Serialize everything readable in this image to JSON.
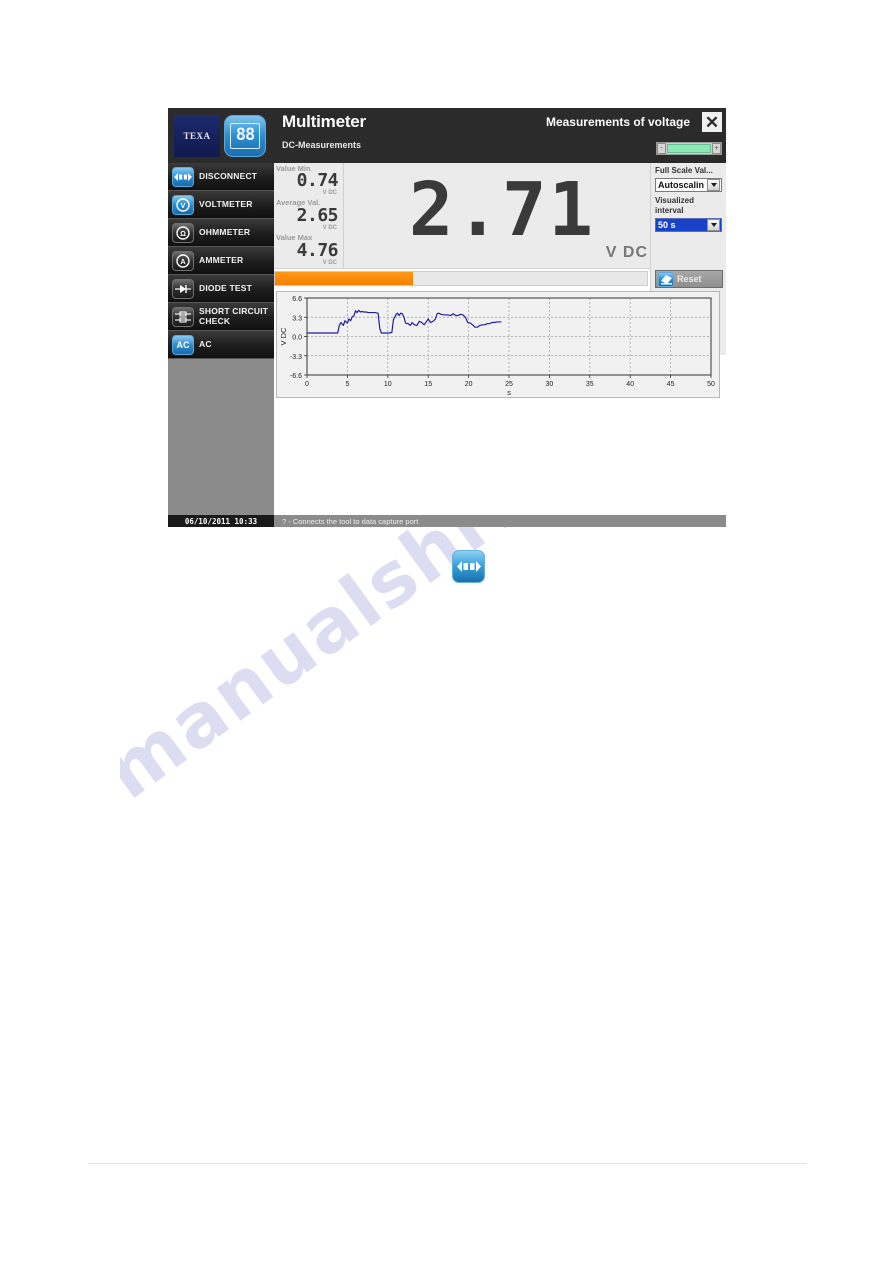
{
  "page": {
    "watermark_text": "manualshive.com"
  },
  "window": {
    "brand": {
      "logo_text": "TEXA",
      "segment_text": "88"
    },
    "title": "Multimeter",
    "subject": "Measurements of voltage",
    "subtitle": "DC-Measurements",
    "close_label": "✕",
    "slider": {
      "minus": "-",
      "plus": "+",
      "fill_percent": 100,
      "color": "#8ee8b5"
    }
  },
  "sidebar": {
    "items": [
      {
        "label": "DISCONNECT",
        "icon": "disconnect-icon",
        "icon_style": "blue",
        "active": true
      },
      {
        "label": "VOLTMETER",
        "icon": "voltmeter-icon",
        "icon_style": "blue",
        "active": false
      },
      {
        "label": "OHMMETER",
        "icon": "ohmmeter-icon",
        "icon_style": "dark",
        "active": false
      },
      {
        "label": "AMMETER",
        "icon": "ammeter-icon",
        "icon_style": "dark",
        "active": false
      },
      {
        "label": "DIODE TEST",
        "icon": "diode-icon",
        "icon_style": "dark",
        "active": false
      },
      {
        "label": "SHORT CIRCUIT CHECK",
        "icon": "short-circuit-icon",
        "icon_style": "dark",
        "active": false
      },
      {
        "label": "AC",
        "icon": "ac-icon",
        "icon_style": "blue",
        "active": false
      }
    ]
  },
  "meter": {
    "reading": "2.71",
    "unit": "V DC",
    "stats": [
      {
        "label": "Value Min",
        "value": "0.74",
        "unit": "V DC"
      },
      {
        "label": "Average Val.",
        "value": "2.65",
        "unit": "V DC"
      },
      {
        "label": "Value Max",
        "value": "4.76",
        "unit": "V DC"
      }
    ],
    "progress_percent": 37,
    "progress_color": "#f77f00",
    "reset_label": "Reset"
  },
  "controls": {
    "full_scale_label": "Full Scale Val...",
    "full_scale_value": "Autoscalin",
    "interval_label": "Visualized interval",
    "interval_value": "50 s"
  },
  "statusbar": {
    "datetime": "06/10/2011 10:33",
    "hint": "? - Connects the tool to data capture port"
  },
  "standalone_icon": {
    "name": "disconnect-icon"
  },
  "chart_data": {
    "type": "line",
    "title": "",
    "xlabel": "s",
    "ylabel": "V DC",
    "xlim": [
      0,
      50
    ],
    "ylim": [
      -6.6,
      6.6
    ],
    "xticks": [
      0,
      5,
      10,
      15,
      20,
      25,
      30,
      35,
      40,
      45,
      50
    ],
    "yticks": [
      6.6,
      3.3,
      0.0,
      -3.3,
      -6.6
    ],
    "ytick_labels": [
      "6.6",
      "3.3",
      "0.0",
      "-3.3",
      "-6.6"
    ],
    "grid": true,
    "legend": null,
    "line_color": "#1f1f9e",
    "series": [
      {
        "name": "V DC",
        "x": [
          0.0,
          1.0,
          2.0,
          3.0,
          3.8,
          4.0,
          4.2,
          4.5,
          4.7,
          5.0,
          5.2,
          5.4,
          5.6,
          5.8,
          6.0,
          6.2,
          6.4,
          6.6,
          6.8,
          7.0,
          7.3,
          7.6,
          8.0,
          8.4,
          8.8,
          9.0,
          9.2,
          9.4,
          9.8,
          10.2,
          10.5,
          10.7,
          11.0,
          11.2,
          11.4,
          11.6,
          11.8,
          12.0,
          12.2,
          12.5,
          12.8,
          13.0,
          13.3,
          13.6,
          13.9,
          14.2,
          14.5,
          14.8,
          15.0,
          15.3,
          15.6,
          15.9,
          16.1,
          16.3,
          16.6,
          17.0,
          17.4,
          17.8,
          18.1,
          18.4,
          18.7,
          19.0,
          19.3,
          19.6,
          19.9,
          20.2,
          20.5,
          20.8,
          21.1,
          21.4,
          21.7,
          22.0,
          22.3,
          22.6,
          22.9,
          23.2,
          23.5,
          23.8,
          24.0
        ],
        "y": [
          0.6,
          0.6,
          0.6,
          0.6,
          0.6,
          1.9,
          2.4,
          1.9,
          2.7,
          2.3,
          3.0,
          2.7,
          3.4,
          3.5,
          4.4,
          4.1,
          4.5,
          4.2,
          4.3,
          4.2,
          4.2,
          4.1,
          4.1,
          4.1,
          4.0,
          1.4,
          0.6,
          0.6,
          0.6,
          0.6,
          0.7,
          2.9,
          3.7,
          4.0,
          3.6,
          4.0,
          3.9,
          3.3,
          2.3,
          2.2,
          1.9,
          2.4,
          2.0,
          1.9,
          2.6,
          2.4,
          2.0,
          2.6,
          3.0,
          2.4,
          2.6,
          3.0,
          3.9,
          4.0,
          3.8,
          3.7,
          3.7,
          3.6,
          3.9,
          3.6,
          3.6,
          3.8,
          3.7,
          3.3,
          2.4,
          2.3,
          2.0,
          1.6,
          1.6,
          1.9,
          2.0,
          2.0,
          2.2,
          2.2,
          2.4,
          2.4,
          2.5,
          2.5,
          2.5
        ]
      }
    ]
  }
}
